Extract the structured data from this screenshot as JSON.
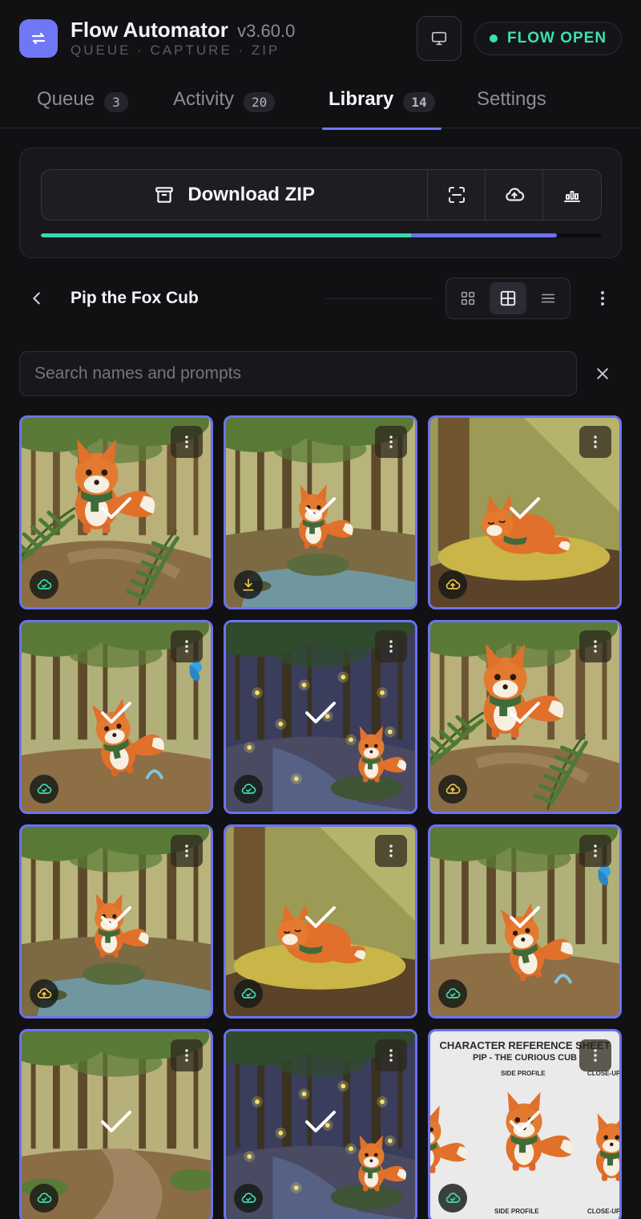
{
  "app": {
    "title": "Flow Automator",
    "version": "v3.60.0",
    "subtitle": "QUEUE · CAPTURE · ZIP",
    "status": "FLOW OPEN"
  },
  "tabs": [
    {
      "label": "Queue",
      "count": "3",
      "active": false
    },
    {
      "label": "Activity",
      "count": "20",
      "active": false
    },
    {
      "label": "Library",
      "count": "14",
      "active": true
    },
    {
      "label": "Settings",
      "count": "",
      "active": false
    }
  ],
  "download": {
    "label": "Download ZIP",
    "progress": {
      "complete": 0.66,
      "total": 0.92
    }
  },
  "album": {
    "title": "Pip the Fox Cub",
    "view_mode": "grid-large"
  },
  "search": {
    "placeholder": "Search names and prompts",
    "value": ""
  },
  "colors": {
    "accent": "#6c72f0",
    "status_green": "#3ddfb3",
    "badge_green": "#3ddfb3",
    "badge_yellow": "#f3c64a"
  },
  "reference_sheet": {
    "title": "CHARACTER REFERENCE SHEET",
    "subtitle": "PIP - THE CURIOUS CUB",
    "labels": [
      "SIDE PROFILE",
      "CLOSE-UP:",
      "SIDE PROFILE",
      "CLOSE-UP"
    ]
  },
  "images": [
    {
      "scene": "fern-closeup",
      "status": "cloud-done",
      "badge_color": "green"
    },
    {
      "scene": "fox-on-rock",
      "status": "download",
      "badge_color": "yellow"
    },
    {
      "scene": "fox-sleeping",
      "status": "cloud-upload",
      "badge_color": "yellow"
    },
    {
      "scene": "fox-leaping-butterfly",
      "status": "cloud-done",
      "badge_color": "green"
    },
    {
      "scene": "fireflies-stream",
      "status": "cloud-done",
      "badge_color": "green"
    },
    {
      "scene": "fern-closeup",
      "status": "cloud-upload",
      "badge_color": "yellow"
    },
    {
      "scene": "fox-on-rock",
      "status": "cloud-upload",
      "badge_color": "yellow"
    },
    {
      "scene": "fox-sleeping",
      "status": "cloud-done",
      "badge_color": "green"
    },
    {
      "scene": "fox-leaping-butterfly",
      "status": "cloud-done",
      "badge_color": "green"
    },
    {
      "scene": "empty-forest-path",
      "status": "cloud-done",
      "badge_color": "green"
    },
    {
      "scene": "fireflies-stream",
      "status": "cloud-done",
      "badge_color": "green"
    },
    {
      "scene": "reference-sheet",
      "status": "cloud-done",
      "badge_color": "green"
    }
  ]
}
